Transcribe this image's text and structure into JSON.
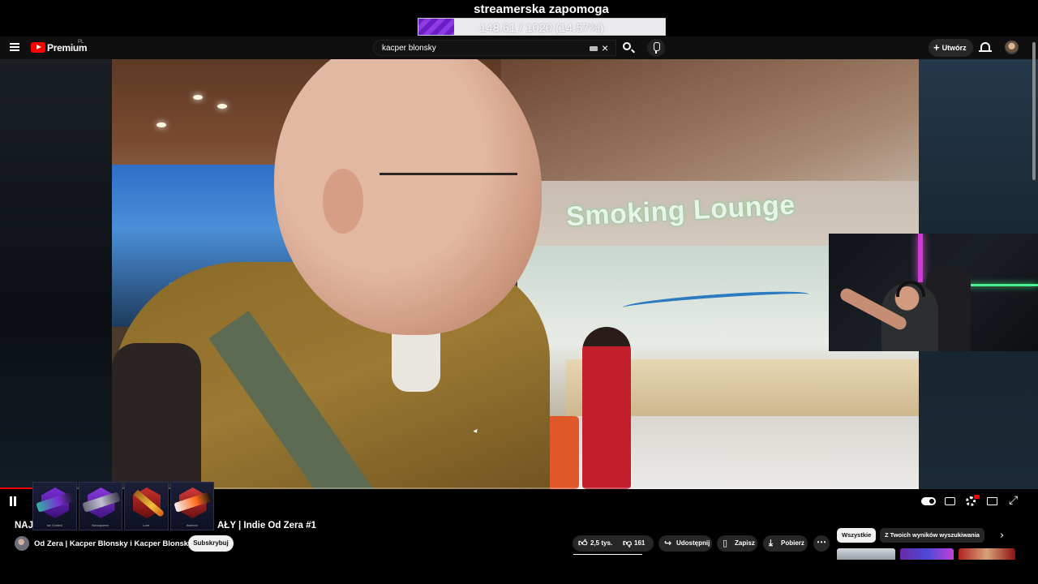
{
  "overlay": {
    "goal_title": "streamerska zapomoga",
    "goal_text": "148.61 / 1020 (14.57%)",
    "goal_fraction": 0.1457,
    "goal_color": "#7a2fd6"
  },
  "header": {
    "brand": "Premium",
    "region": "PL",
    "search_value": "kacper blonsky",
    "create_label": "Utwórz",
    "icons": [
      "menu-icon",
      "youtube-logo",
      "keyboard-icon",
      "clear-icon",
      "search-icon",
      "mic-icon",
      "plus-icon",
      "bell-icon"
    ]
  },
  "video": {
    "sign_text": "Smoking Lounge",
    "progress_fraction": 0.035
  },
  "skins": [
    {
      "name": "Ice Coaled"
    },
    {
      "name": "Nanoqueen"
    },
    {
      "name": "Lore"
    },
    {
      "name": "Asiimov"
    }
  ],
  "metadata": {
    "title_prefix": "NAJ",
    "title": "AŁY | Indie Od Zera #1",
    "channel": "Od Zera | Kacper Blonsky i Kacper Blonsky",
    "subscribe_label": "Subskrybuj"
  },
  "actions": {
    "likes": "2,5 tys.",
    "dislikes": "161",
    "share": "Udostępnij",
    "save": "Zapisz",
    "download": "Pobierz",
    "more": "⋯"
  },
  "chips": {
    "all": "Wszystkie",
    "related": "Z Twoich wyników wyszukiwania",
    "next": "›"
  },
  "colors": {
    "yt_red": "#ff0000",
    "background": "#0f0f0f",
    "chip_active": "#f1f1f1"
  }
}
